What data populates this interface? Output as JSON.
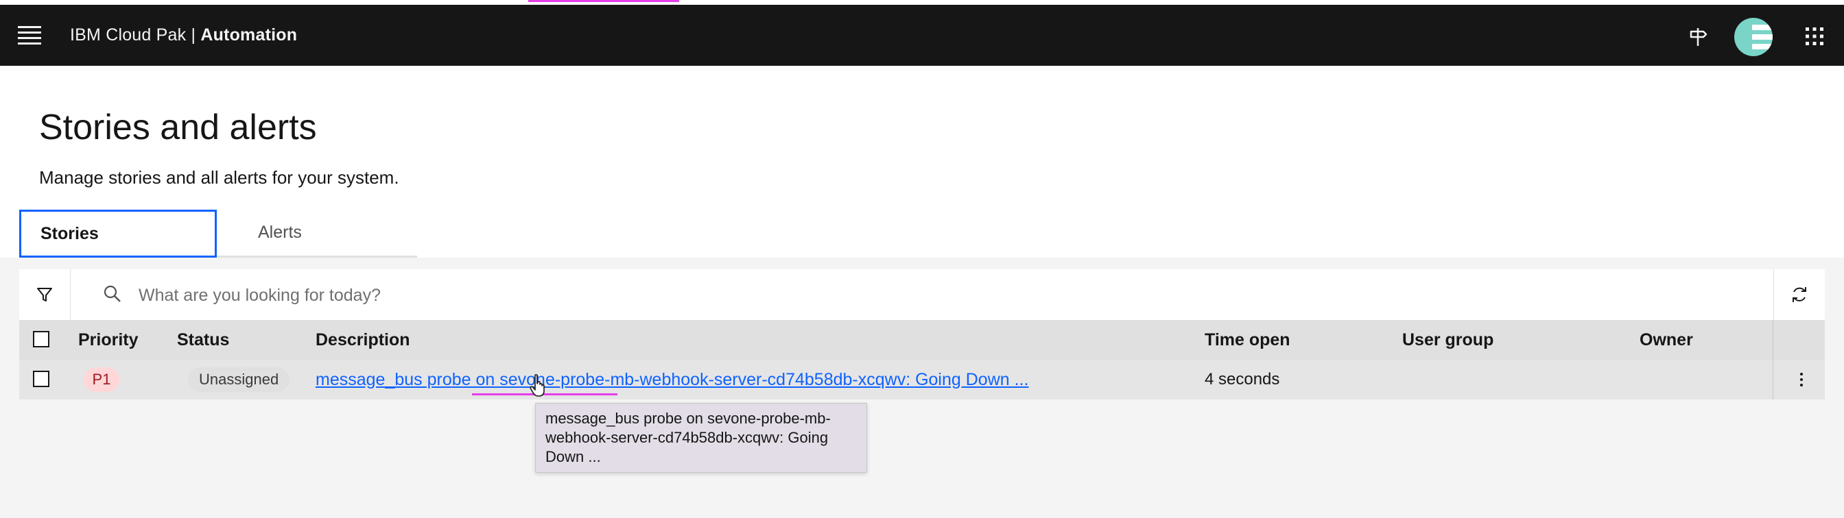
{
  "header": {
    "brand_prefix": "IBM Cloud Pak | ",
    "brand_product": "Automation"
  },
  "page": {
    "title": "Stories and alerts",
    "subtitle": "Manage stories and all alerts for your system."
  },
  "tabs": [
    {
      "label": "Stories",
      "active": true
    },
    {
      "label": "Alerts",
      "active": false
    }
  ],
  "search": {
    "placeholder": "What are you looking for today?"
  },
  "table": {
    "columns": [
      "Priority",
      "Status",
      "Description",
      "Time open",
      "User group",
      "Owner"
    ],
    "rows": [
      {
        "priority": "P1",
        "status": "Unassigned",
        "description": "message_bus probe on sevone-probe-mb-webhook-server-cd74b58db-xcqwv: Going Down ...",
        "time_open": "4 seconds",
        "user_group": "",
        "owner": ""
      }
    ]
  },
  "tooltip": {
    "text": "message_bus probe on sevone-probe-mb-webhook-server-cd74b58db-xcqwv: Going Down ..."
  },
  "icons": {
    "menu": "hamburger-menu-icon",
    "signpost": "signpost-icon",
    "avatar": "user-avatar",
    "switcher": "app-switcher-grid-icon",
    "filter": "filter-icon",
    "search": "search-icon",
    "refresh": "refresh-icon",
    "overflow": "overflow-menu-icon",
    "cursor": "hand-pointer-cursor-icon"
  },
  "colors": {
    "header_bg": "#161616",
    "link": "#0f62fe",
    "active_tab_border": "#0f62fe",
    "priority_badge_bg": "#ffd7d9",
    "priority_badge_text": "#a2191f",
    "avatar": "#7ad4c8",
    "annotation_pink": "#e73eea"
  }
}
